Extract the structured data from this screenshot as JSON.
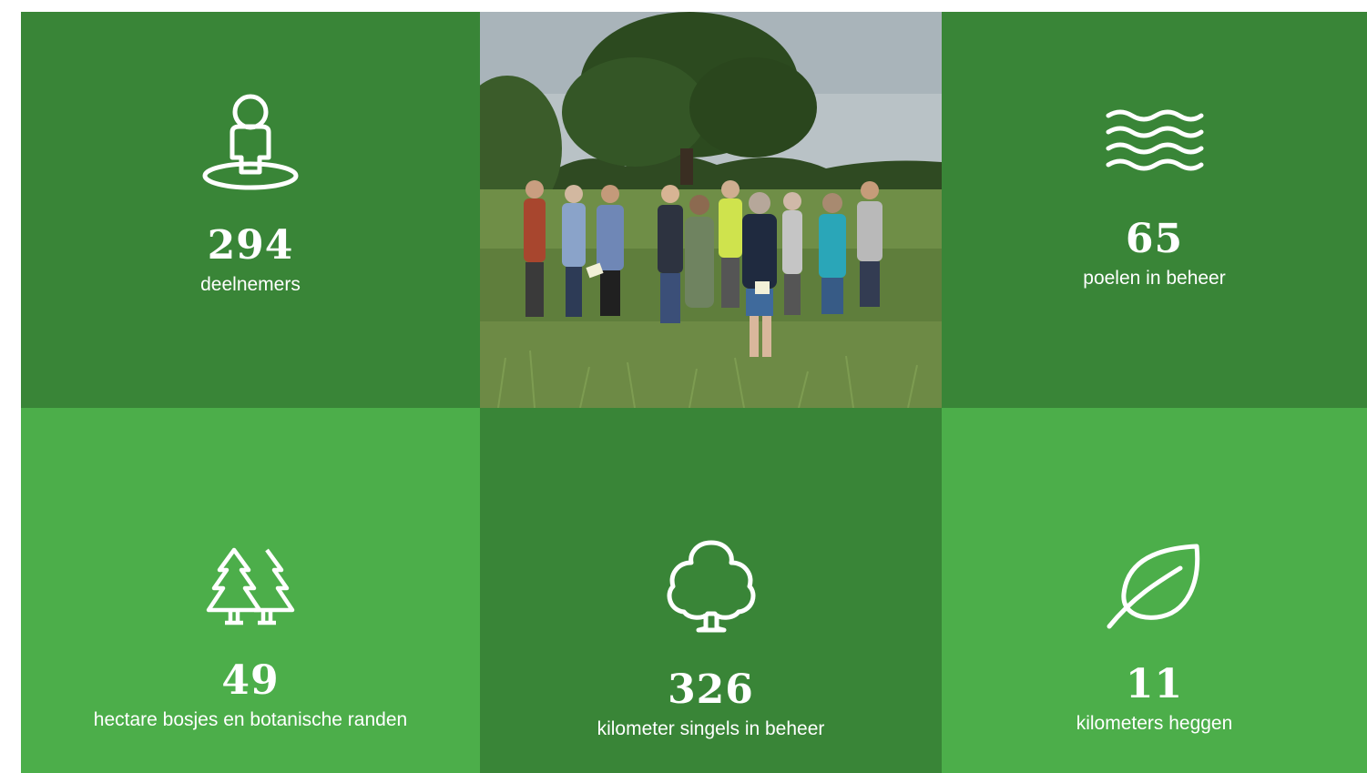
{
  "stats": {
    "participants": {
      "value": "294",
      "label": "deelnemers",
      "icon": "person-location-icon"
    },
    "ponds": {
      "value": "65",
      "label": "poelen in beheer",
      "icon": "waves-icon"
    },
    "woodlands": {
      "value": "49",
      "label": "hectare bosjes en botanische randen",
      "icon": "pine-trees-icon"
    },
    "tree_rows": {
      "value": "326",
      "label": "kilometer singels in beheer",
      "icon": "tree-icon"
    },
    "hedges": {
      "value": "11",
      "label": "kilometers heggen",
      "icon": "leaf-icon"
    }
  },
  "photo": {
    "subject": "group of people standing in a grass field with trees"
  },
  "colors": {
    "dark_green": "#398537",
    "light_green": "#4cae4a",
    "text": "#ffffff"
  }
}
